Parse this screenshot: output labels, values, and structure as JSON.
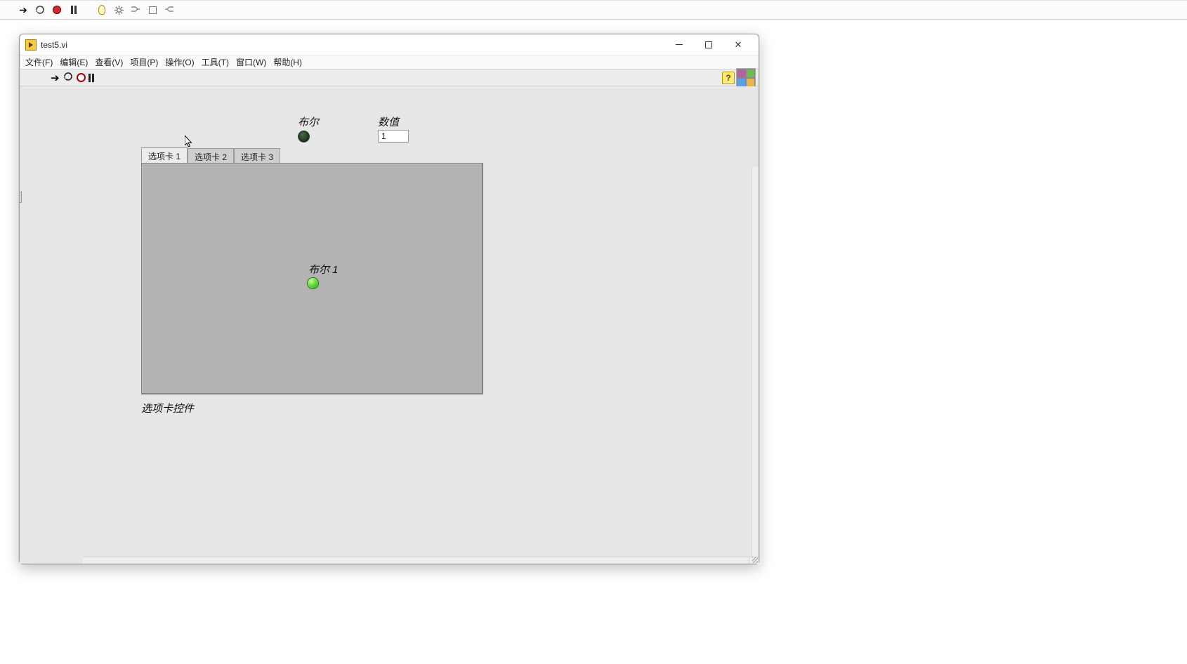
{
  "outerToolbar": {
    "run": "▶",
    "loop": "↻",
    "abort": "●",
    "pause": "❚❚"
  },
  "window": {
    "title": "test5.vi"
  },
  "menu": {
    "file": "文件(F)",
    "edit": "编辑(E)",
    "view": "查看(V)",
    "project": "项目(P)",
    "operate": "操作(O)",
    "tools": "工具(T)",
    "window": "窗口(W)",
    "help": "帮助(H)"
  },
  "viToolbar": {
    "help_q": "?"
  },
  "panel": {
    "bool_label": "布尔",
    "numeric_label": "数值",
    "numeric_value": "1",
    "tab1": "选项卡 1",
    "tab2": "选项卡 2",
    "tab3": "选项卡 3",
    "bool1_label": "布尔 1",
    "tabctl_caption": "选项卡控件"
  }
}
